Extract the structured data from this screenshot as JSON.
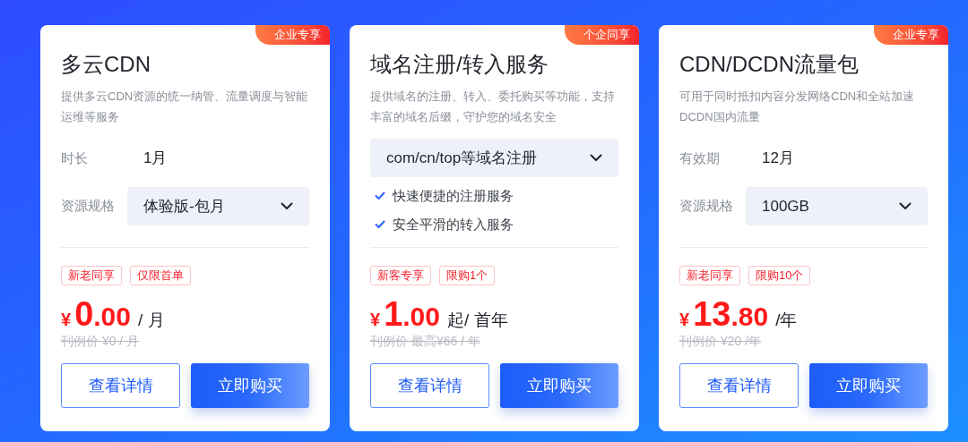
{
  "cards": [
    {
      "badge": "企业专享",
      "title": "多云CDN",
      "description": "提供多云CDN资源的统一纳管、流量调度与智能运维等服务",
      "options": [
        {
          "kind": "text",
          "label": "时长",
          "value": "1月"
        },
        {
          "kind": "select",
          "label": "资源规格",
          "value": "体验版-包月"
        }
      ],
      "tags": [
        "新老同享",
        "仅限首单"
      ],
      "price": {
        "currency": "¥",
        "integer": "0",
        "decimal": ".00",
        "unit": "/ 月"
      },
      "original_price": "刊例价 ¥0 / 月",
      "buttons": [
        "查看详情",
        "立即购买"
      ]
    },
    {
      "badge": "个企同享",
      "title": "域名注册/转入服务",
      "description": "提供域名的注册、转入、委托购买等功能，支持丰富的域名后缀，守护您的域名安全",
      "options": [
        {
          "kind": "select",
          "value": "com/cn/top等域名注册"
        },
        {
          "kind": "check",
          "value": "快速便捷的注册服务"
        },
        {
          "kind": "check",
          "value": "安全平滑的转入服务"
        }
      ],
      "tags": [
        "新客专享",
        "限购1个"
      ],
      "price": {
        "currency": "¥",
        "integer": "1",
        "decimal": ".00",
        "unit": "起/ 首年"
      },
      "original_price": "刊例价 最高¥66 / 年",
      "buttons": [
        "查看详情",
        "立即购买"
      ]
    },
    {
      "badge": "企业专享",
      "title": "CDN/DCDN流量包",
      "description": "可用于同时抵扣内容分发网络CDN和全站加速DCDN国内流量",
      "options": [
        {
          "kind": "text",
          "label": "有效期",
          "value": "12月"
        },
        {
          "kind": "select",
          "label": "资源规格",
          "value": "100GB"
        }
      ],
      "tags": [
        "新老同享",
        "限购10个"
      ],
      "price": {
        "currency": "¥",
        "integer": "13",
        "decimal": ".80",
        "unit": "/年"
      },
      "original_price": "刊例价 ¥20 /年",
      "buttons": [
        "查看详情",
        "立即购买"
      ]
    }
  ]
}
